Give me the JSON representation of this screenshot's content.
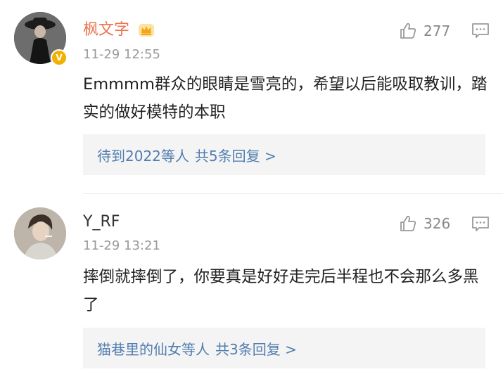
{
  "comments": [
    {
      "username": "枫文字",
      "time": "11-29 12:55",
      "likes": "277",
      "text": "Emmmm群众的眼睛是雪亮的，希望以后能吸取教训，踏实的做好模特的本职",
      "replies": {
        "who": "待到2022等人",
        "count_text": "共5条回复 >"
      },
      "verified": true
    },
    {
      "username": "Y_RF",
      "time": "11-29 13:21",
      "likes": "326",
      "text": "摔倒就摔倒了，你要真是好好走完后半程也不会那么多黑了",
      "replies": {
        "who": "猫巷里的仙女等人",
        "count_text": "共3条回复 >"
      },
      "verified": false
    }
  ],
  "icons": {
    "like": "thumbs-up-icon",
    "reply": "comment-bubble-icon",
    "crown": "crown-badge-icon",
    "verified": "verified-v-icon"
  },
  "colors": {
    "vip_name": "#eb7350",
    "link": "#507daf",
    "muted": "#999999",
    "reply_bg": "#f4f4f4",
    "verified_badge": "#f4b000"
  }
}
